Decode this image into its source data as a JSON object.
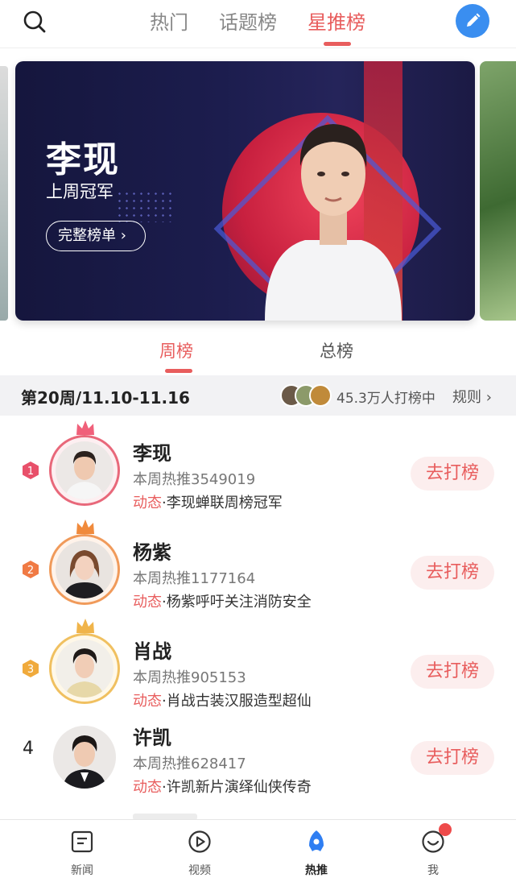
{
  "topnav": {
    "tabs": [
      {
        "label": "热门",
        "active": false
      },
      {
        "label": "话题榜",
        "active": false
      },
      {
        "label": "星推榜",
        "active": true
      }
    ],
    "search_icon": "search-icon",
    "edit_icon": "pencil-icon"
  },
  "banner": {
    "name": "李现",
    "subtitle": "上周冠军",
    "button_label": "完整榜单 ›"
  },
  "subtabs": [
    {
      "label": "周榜",
      "active": true
    },
    {
      "label": "总榜",
      "active": false
    }
  ],
  "week": {
    "title": "第20周/11.10-11.16",
    "fans_text": "45.3万人打榜中",
    "rules_label": "规则 ›"
  },
  "list": [
    {
      "rank": "1",
      "name": "李现",
      "score": "本周热推3549019",
      "dyn_tag": "动态",
      "dyn_text": "·李现蝉联周榜冠军",
      "button": "去打榜"
    },
    {
      "rank": "2",
      "name": "杨紫",
      "score": "本周热推1177164",
      "dyn_tag": "动态",
      "dyn_text": "·杨紫呼吁关注消防安全",
      "button": "去打榜"
    },
    {
      "rank": "3",
      "name": "肖战",
      "score": "本周热推905153",
      "dyn_tag": "动态",
      "dyn_text": "·肖战古装汉服造型超仙",
      "button": "去打榜"
    },
    {
      "rank": "4",
      "name": "许凯",
      "score": "本周热推628417",
      "dyn_tag": "动态",
      "dyn_text": "·许凯新片演绎仙侠传奇",
      "button": "去打榜"
    }
  ],
  "bottomnav": [
    {
      "label": "新闻",
      "icon": "news-icon",
      "active": false
    },
    {
      "label": "视频",
      "icon": "play-icon",
      "active": false
    },
    {
      "label": "热推",
      "icon": "rocket-icon",
      "active": true
    },
    {
      "label": "我",
      "icon": "smiley-icon",
      "active": false
    }
  ],
  "colors": {
    "accent": "#e85d5d",
    "blue": "#3a8ef0",
    "gold": "#f0b44a"
  }
}
